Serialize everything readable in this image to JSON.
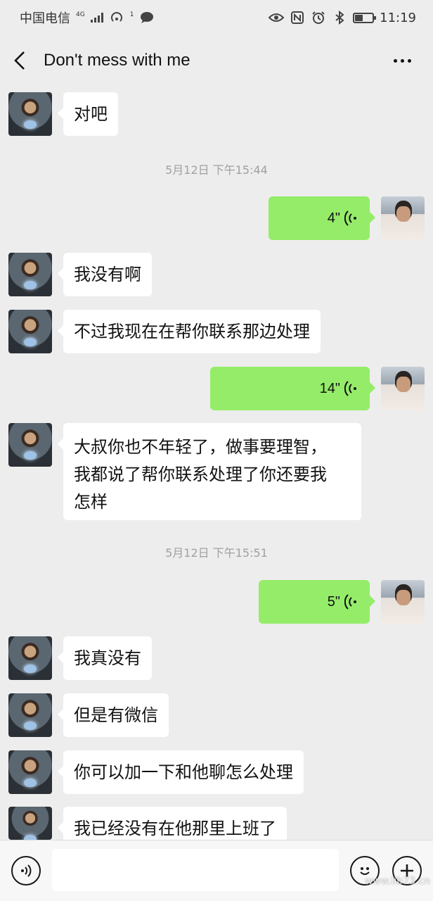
{
  "status_bar": {
    "carrier": "中国电信",
    "network": "4G",
    "notification_count": "1",
    "time": "11:19",
    "battery_level": 0.45
  },
  "header": {
    "title": "Don't mess with me"
  },
  "messages": [
    {
      "side": "left",
      "type": "text",
      "text": "对吧"
    },
    {
      "type": "timestamp",
      "text": "5月12日 下午15:44"
    },
    {
      "side": "right",
      "type": "voice",
      "duration": "4\""
    },
    {
      "side": "left",
      "type": "text",
      "text": "我没有啊"
    },
    {
      "side": "left",
      "type": "text",
      "text": "不过我现在在帮你联系那边处理"
    },
    {
      "side": "right",
      "type": "voice",
      "duration": "14\""
    },
    {
      "side": "left",
      "type": "text",
      "lines": [
        "大叔你也不年轻了，做事要理智，",
        "我都说了帮你联系处理了你还要我",
        "怎样"
      ]
    },
    {
      "type": "timestamp",
      "text": "5月12日 下午15:51"
    },
    {
      "side": "right",
      "type": "voice",
      "duration": "5\""
    },
    {
      "side": "left",
      "type": "text",
      "text": "我真没有"
    },
    {
      "side": "left",
      "type": "text",
      "text": "但是有微信"
    },
    {
      "side": "left",
      "type": "text",
      "text": "你可以加一下和他聊怎么处理"
    },
    {
      "side": "left",
      "type": "text",
      "text": "我已经没有在他那里上班了"
    }
  ],
  "input_bar": {
    "input_value": "",
    "watermark": "www.lib73.cn"
  },
  "icons": {
    "back": "chevron-left-icon",
    "more": "more-dots-icon",
    "voice_toggle": "voice-icon",
    "emoji": "emoji-icon",
    "plus": "plus-icon"
  }
}
